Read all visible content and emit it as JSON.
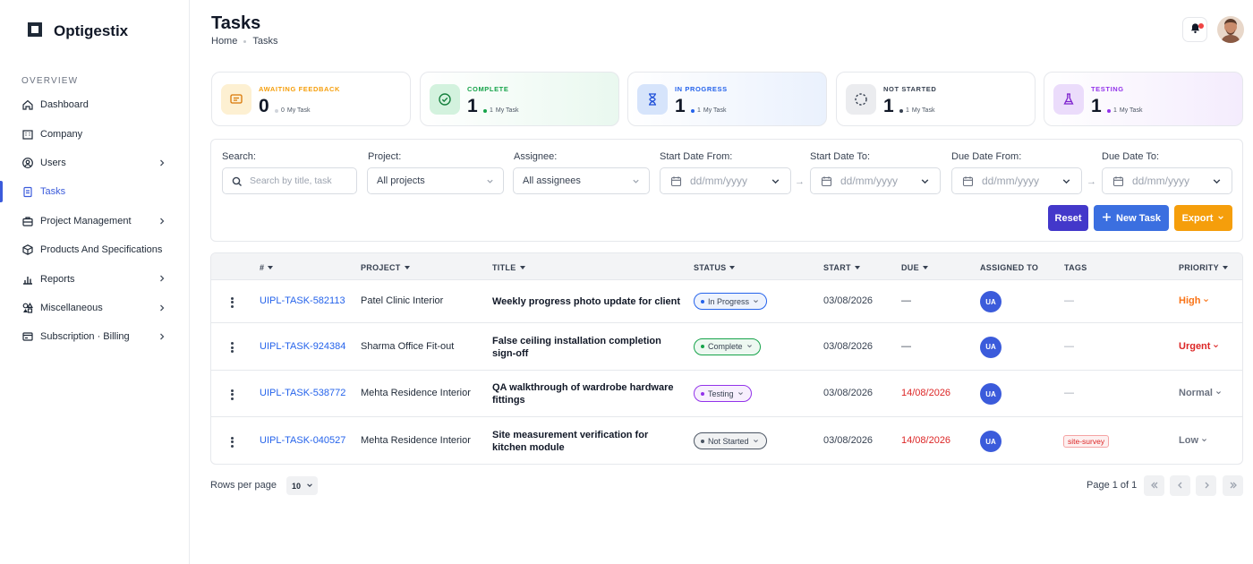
{
  "app": {
    "brand": "Optigestix"
  },
  "sidebar": {
    "section_label": "OVERVIEW",
    "items": [
      {
        "label": "Dashboard",
        "icon": "home-icon",
        "has_chevron": false,
        "active": false
      },
      {
        "label": "Company",
        "icon": "building-icon",
        "has_chevron": false,
        "active": false
      },
      {
        "label": "Users",
        "icon": "user-circle-icon",
        "has_chevron": true,
        "active": false
      },
      {
        "label": "Tasks",
        "icon": "clipboard-icon",
        "has_chevron": false,
        "active": true
      },
      {
        "label": "Project Management",
        "icon": "briefcase-icon",
        "has_chevron": true,
        "active": false
      },
      {
        "label": "Products And Specifications",
        "icon": "box-icon",
        "has_chevron": false,
        "active": false
      },
      {
        "label": "Reports",
        "icon": "bar-chart-icon",
        "has_chevron": true,
        "active": false
      },
      {
        "label": "Miscellaneous",
        "icon": "shapes-icon",
        "has_chevron": true,
        "active": false
      },
      {
        "label": "Subscription · Billing",
        "icon": "billing-icon",
        "has_chevron": true,
        "active": false
      }
    ]
  },
  "header": {
    "title": "Tasks",
    "breadcrumb": [
      "Home",
      "Tasks"
    ]
  },
  "stats": [
    {
      "label": "AWAITING FEEDBACK",
      "value": "0",
      "sub_count": "0",
      "sub_label": "My Task",
      "color": "#f59e0b",
      "icon": "message-icon"
    },
    {
      "label": "COMPLETE",
      "value": "1",
      "sub_count": "1",
      "sub_label": "My Task",
      "color": "#16a34a",
      "icon": "check-circle-icon"
    },
    {
      "label": "IN PROGRESS",
      "value": "1",
      "sub_count": "1",
      "sub_label": "My Task",
      "color": "#2563eb",
      "icon": "hourglass-icon"
    },
    {
      "label": "NOT STARTED",
      "value": "1",
      "sub_count": "1",
      "sub_label": "My Task",
      "color": "#374151",
      "icon": "dashed-circle-icon"
    },
    {
      "label": "TESTING",
      "value": "1",
      "sub_count": "1",
      "sub_label": "My Task",
      "color": "#9333ea",
      "icon": "flask-icon"
    }
  ],
  "filters": {
    "search_label": "Search:",
    "search_placeholder": "Search by title, task",
    "project_label": "Project:",
    "project_value": "All projects",
    "assignee_label": "Assignee:",
    "assignee_value": "All assignees",
    "start_from_label": "Start Date From:",
    "start_to_label": "Start Date To:",
    "due_from_label": "Due Date From:",
    "due_to_label": "Due Date To:",
    "date_placeholder": "dd/mm/yyyy",
    "arrow": "→",
    "reset_label": "Reset",
    "new_task_label": "New Task",
    "export_label": "Export"
  },
  "table": {
    "columns": [
      "#",
      "PROJECT",
      "TITLE",
      "STATUS",
      "START",
      "DUE",
      "ASSIGNED TO",
      "TAGS",
      "PRIORITY"
    ],
    "rows": [
      {
        "id": "UIPL-TASK-582113",
        "project": "Patel Clinic Interior",
        "title": "Weekly progress photo update for client",
        "status": "In Progress",
        "status_color": "#2563eb",
        "start": "03/08/2026",
        "due": "—",
        "due_overdue": false,
        "assignee": "UA",
        "tag": "—",
        "priority": "High",
        "priority_color": "#f97316"
      },
      {
        "id": "UIPL-TASK-924384",
        "project": "Sharma Office Fit-out",
        "title": "False ceiling installation completion sign-off",
        "status": "Complete",
        "status_color": "#16a34a",
        "start": "03/08/2026",
        "due": "—",
        "due_overdue": false,
        "assignee": "UA",
        "tag": "—",
        "priority": "Urgent",
        "priority_color": "#dc2626"
      },
      {
        "id": "UIPL-TASK-538772",
        "project": "Mehta Residence Interior",
        "title": "QA walkthrough of wardrobe hardware fittings",
        "status": "Testing",
        "status_color": "#9333ea",
        "start": "03/08/2026",
        "due": "14/08/2026",
        "due_overdue": true,
        "assignee": "UA",
        "tag": "—",
        "priority": "Normal",
        "priority_color": "#6b7280"
      },
      {
        "id": "UIPL-TASK-040527",
        "project": "Mehta Residence Interior",
        "title": "Site measurement verification for kitchen module",
        "status": "Not Started",
        "status_color": "#4b5563",
        "start": "03/08/2026",
        "due": "14/08/2026",
        "due_overdue": true,
        "assignee": "UA",
        "tag": "site-survey",
        "priority": "Low",
        "priority_color": "#6b7280"
      }
    ]
  },
  "pagination": {
    "rows_label": "Rows per page",
    "rows_value": "10",
    "page_text": "Page 1 of 1"
  }
}
